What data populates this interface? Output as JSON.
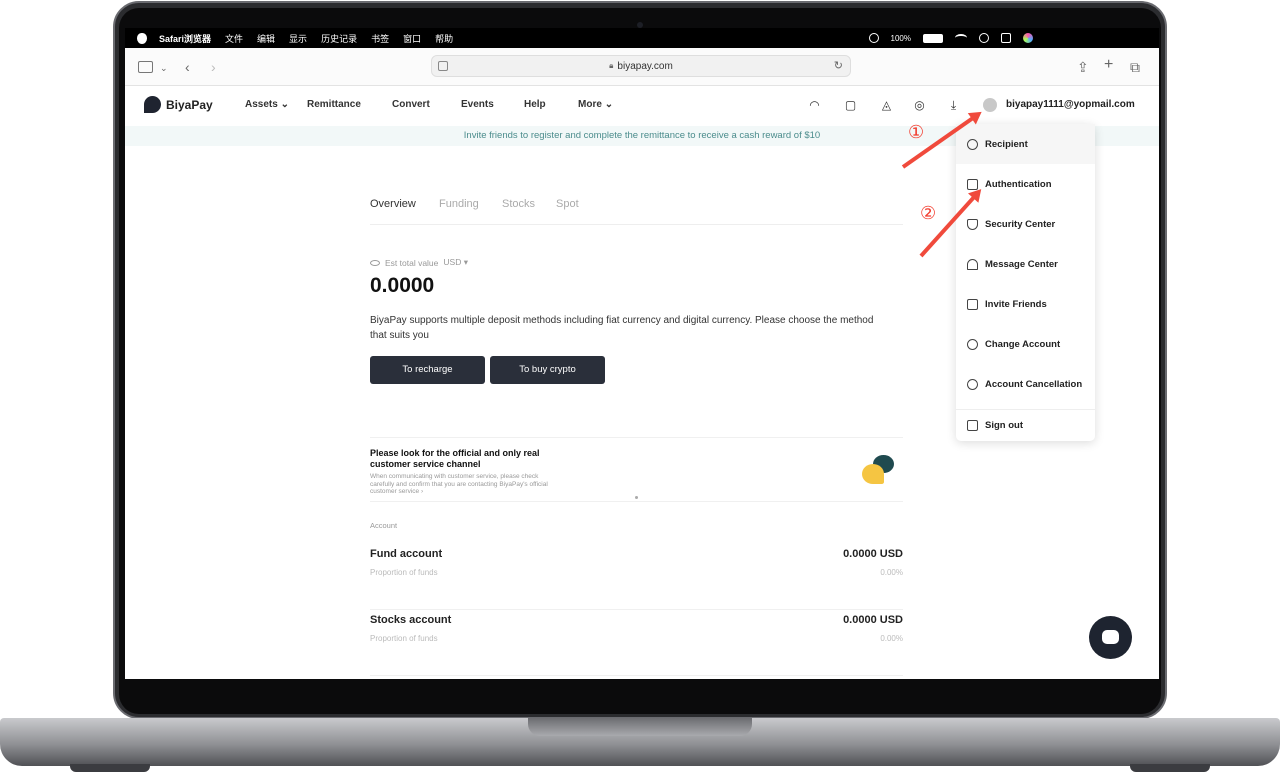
{
  "menubar": {
    "app": "Safari浏览器",
    "items": [
      "文件",
      "编辑",
      "显示",
      "历史记录",
      "书签",
      "窗口",
      "帮助"
    ],
    "battery": "100%"
  },
  "browser": {
    "url": "biyapay.com"
  },
  "site": {
    "brand": "BiyaPay",
    "nav": [
      "Assets",
      "Remittance",
      "Convert",
      "Events",
      "Help",
      "More"
    ],
    "user_email": "biyapay1111@yopmail.com",
    "banner": "Invite friends to register and complete the remittance to receive a cash reward of $10"
  },
  "tabs": [
    "Overview",
    "Funding",
    "Stocks",
    "Spot"
  ],
  "summary": {
    "est_label": "Est total value",
    "currency": "USD",
    "total": "0.0000",
    "description": "BiyaPay supports multiple deposit methods including fiat currency and digital currency. Please choose the method that suits you",
    "recharge_label": "To recharge",
    "buy_crypto_label": "To buy crypto"
  },
  "customer_service": {
    "title": "Please look for the official and only real customer service channel",
    "subtitle": "When communicating with customer service, please check carefully and confirm that you are contacting BiyaPay's official customer service"
  },
  "accounts": {
    "label": "Account",
    "rows": [
      {
        "name": "Fund account",
        "value": "0.0000 USD",
        "sub": "Proportion of funds",
        "pct": "0.00%"
      },
      {
        "name": "Stocks account",
        "value": "0.0000 USD",
        "sub": "Proportion of funds",
        "pct": "0.00%"
      }
    ]
  },
  "dropdown": {
    "items": [
      "Recipient",
      "Authentication",
      "Security Center",
      "Message Center",
      "Invite Friends",
      "Change Account",
      "Account Cancellation"
    ],
    "signout": "Sign out"
  },
  "annotations": [
    "①",
    "②"
  ],
  "colors": {
    "accent_dark": "#2a2f3a",
    "banner_text": "#4b8c8c",
    "annotation_red": "#f04a3c"
  }
}
